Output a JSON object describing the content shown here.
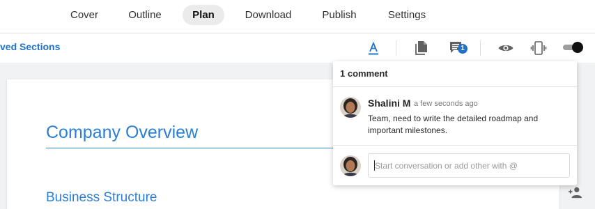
{
  "nav": {
    "tabs": [
      {
        "label": "Cover"
      },
      {
        "label": "Outline"
      },
      {
        "label": "Plan",
        "active": true
      },
      {
        "label": "Download"
      },
      {
        "label": "Publish"
      },
      {
        "label": "Settings"
      }
    ]
  },
  "toolbar": {
    "saved_sections_label": "ved Sections",
    "comment_count_badge": "1",
    "icons": [
      "text-format-icon",
      "document-icon",
      "comments-icon",
      "eye-icon",
      "device-preview-icon"
    ],
    "toggle_on": true
  },
  "document": {
    "title": "Company Overview",
    "subtitle": "Business Structure"
  },
  "comments_panel": {
    "header": "1 comment",
    "comment": {
      "author": "Shalini M",
      "timestamp": "a few seconds ago",
      "text": "Team, need to write the detailed roadmap and important milestones."
    },
    "reply_placeholder": "Start conversation or add other with @"
  },
  "colors": {
    "accent": "#1e73c9",
    "heading": "#2b7fd4",
    "active_tab_bg": "#ebebeb",
    "canvas_bg": "#f1f2f3"
  }
}
